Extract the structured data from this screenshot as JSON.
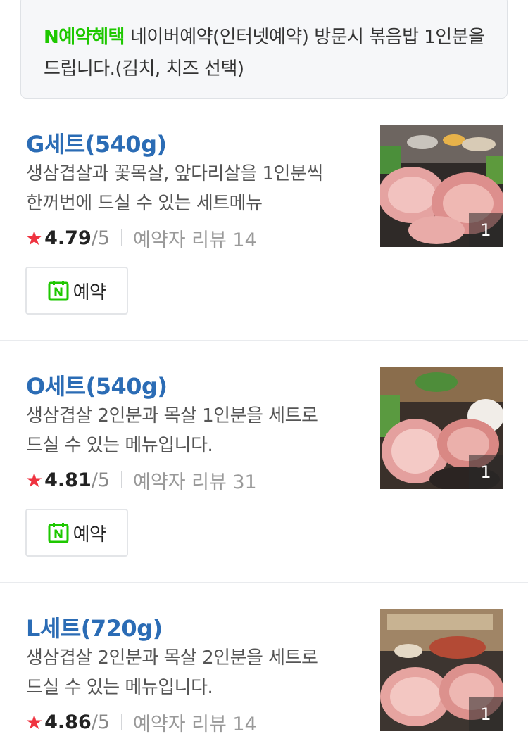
{
  "benefit": {
    "tag": "N예약혜택",
    "text": "네이버예약(인터넷예약) 방문시 볶음밥 1인분을 드립니다.(김치, 치즈 선택)"
  },
  "menus": [
    {
      "title": "G세트(540g)",
      "desc_line1": "생삼겹살과 꽃목살, 앞다리살을 1인분씩",
      "desc_line2": "한꺼번에 드실 수 있는 세트메뉴",
      "star": "★",
      "score": "4.79",
      "score_max": "/5",
      "review": "예약자 리뷰 14",
      "reserve_label": "예약",
      "naver_icon": "naver-n-calendar-icon",
      "photo_count": "1"
    },
    {
      "title": "O세트(540g)",
      "desc_line1": "생삼겹살 2인분과 목살 1인분을 세트로",
      "desc_line2": "드실 수 있는 메뉴입니다.",
      "star": "★",
      "score": "4.81",
      "score_max": "/5",
      "review": "예약자 리뷰 31",
      "reserve_label": "예약",
      "naver_icon": "naver-n-calendar-icon",
      "photo_count": "1"
    },
    {
      "title": "L세트(720g)",
      "desc_line1": "생삼겹살 2인분과 목살 2인분을 세트로",
      "desc_line2": "드실 수 있는 메뉴입니다.",
      "star": "★",
      "score": "4.86",
      "score_max": "/5",
      "review": "예약자 리뷰 14",
      "photo_count": "1"
    }
  ],
  "colors": {
    "benefit_tag": "#1ec800",
    "menu_title": "#2b6cb5",
    "star": "#ef3340",
    "naver_green": "#1ec800"
  }
}
